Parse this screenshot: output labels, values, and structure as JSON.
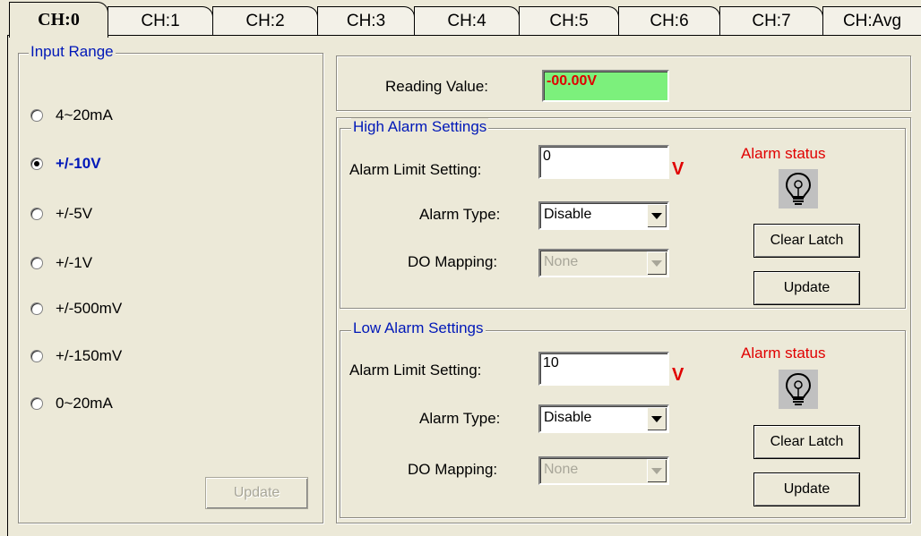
{
  "tabs": [
    "CH:0",
    "CH:1",
    "CH:2",
    "CH:3",
    "CH:4",
    "CH:5",
    "CH:6",
    "CH:7",
    "CH:Avg"
  ],
  "input_range": {
    "legend": "Input Range",
    "options": [
      "4~20mA",
      "+/-10V",
      "+/-5V",
      "+/-1V",
      "+/-500mV",
      "+/-150mV",
      "0~20mA"
    ],
    "selected_index": 1,
    "update_label": "Update"
  },
  "reading": {
    "label": "Reading Value:",
    "value": "-00.00V"
  },
  "high_alarm": {
    "legend": "High Alarm Settings",
    "limit_label": "Alarm Limit Setting:",
    "limit_value": "0",
    "unit": "V",
    "type_label": "Alarm Type:",
    "type_value": "Disable",
    "do_label": "DO Mapping:",
    "do_value": "None",
    "status_label": "Alarm status",
    "clear_label": "Clear Latch",
    "update_label": "Update"
  },
  "low_alarm": {
    "legend": "Low Alarm Settings",
    "limit_label": "Alarm Limit Setting:",
    "limit_value": "10",
    "unit": "V",
    "type_label": "Alarm Type:",
    "type_value": "Disable",
    "do_label": "DO Mapping:",
    "do_value": "None",
    "status_label": "Alarm status",
    "clear_label": "Clear Latch",
    "update_label": "Update"
  },
  "colors": {
    "legend": "#0018b8",
    "alarm": "#e00000",
    "reading_bg": "#7cf07c"
  },
  "icons": {
    "alarm_indicator": "lightbulb-icon"
  }
}
